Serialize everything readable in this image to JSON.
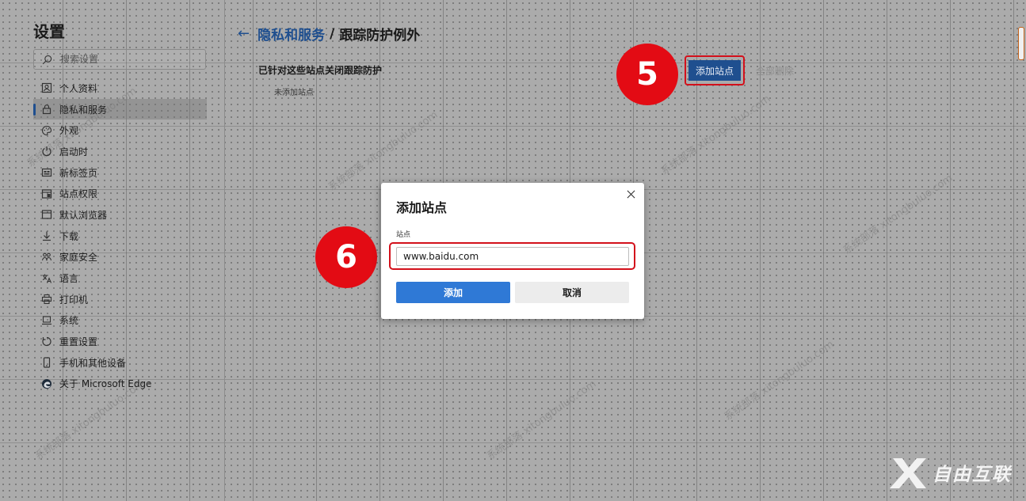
{
  "sidebar": {
    "title": "设置",
    "search_placeholder": "搜索设置",
    "items": [
      {
        "label": "个人资料",
        "icon": "profile-icon"
      },
      {
        "label": "隐私和服务",
        "icon": "lock-icon",
        "active": true
      },
      {
        "label": "外观",
        "icon": "palette-icon"
      },
      {
        "label": "启动时",
        "icon": "power-icon"
      },
      {
        "label": "新标签页",
        "icon": "new-tab-icon"
      },
      {
        "label": "站点权限",
        "icon": "site-permissions-icon"
      },
      {
        "label": "默认浏览器",
        "icon": "browser-icon"
      },
      {
        "label": "下载",
        "icon": "download-icon"
      },
      {
        "label": "家庭安全",
        "icon": "family-icon"
      },
      {
        "label": "语言",
        "icon": "language-icon"
      },
      {
        "label": "打印机",
        "icon": "printer-icon"
      },
      {
        "label": "系统",
        "icon": "system-icon"
      },
      {
        "label": "重置设置",
        "icon": "reset-icon"
      },
      {
        "label": "手机和其他设备",
        "icon": "phone-icon"
      },
      {
        "label": "关于 Microsoft Edge",
        "icon": "edge-icon"
      }
    ]
  },
  "header": {
    "back_arrow": "←",
    "parent": "隐私和服务",
    "separator": "/",
    "current": "跟踪防护例外"
  },
  "main": {
    "section_title": "已针对这些站点关闭跟踪防护",
    "empty_text": "未添加站点",
    "add_site_label": "添加站点",
    "remove_all_label": "全部删除"
  },
  "dialog": {
    "title": "添加站点",
    "close_glyph": "×",
    "field_label": "站点",
    "site_value": "www.baidu.com",
    "add_label": "添加",
    "cancel_label": "取消"
  },
  "annotations": {
    "step5": "5",
    "step6": "6"
  },
  "logo": {
    "text": "自由互联"
  },
  "colors": {
    "accent": "#1f4f8f",
    "primary_button": "#2f79d6",
    "highlight": "#d3101b",
    "badge": "#e30b14"
  }
}
